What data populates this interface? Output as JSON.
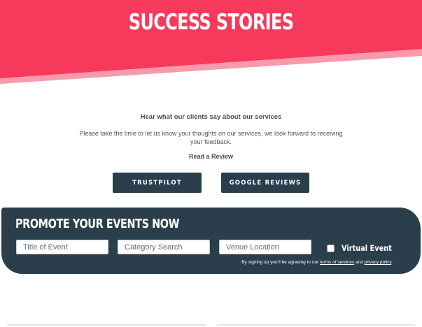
{
  "hero": {
    "title": "SUCCESS STORIES",
    "color_primary": "#f7395b",
    "color_secondary": "#f79aab"
  },
  "intro": {
    "heading": "Hear what our clients say about our services",
    "body": "Please take the time to let us know your thoughts on our services, we look forward to receiving your feedback.",
    "read_label": "Read a Review"
  },
  "buttons": {
    "trustpilot": "TRUSTPILOT",
    "google": "GOOGLE REVIEWS"
  },
  "events": {
    "title": "PROMOTE YOUR EVENTS NOW",
    "title_placeholder": "Title of Event",
    "category_placeholder": "Category Search",
    "venue_placeholder": "Venue Location",
    "virtual_label": "Virtual Event",
    "virtual_checked": false,
    "legal_prefix": "By signing up you'll be agreeing to our",
    "terms_link": "terms of services",
    "legal_and": "and",
    "privacy_link": "privacy policy",
    "legal_suffix": ".",
    "background": "#2b3e4c"
  }
}
